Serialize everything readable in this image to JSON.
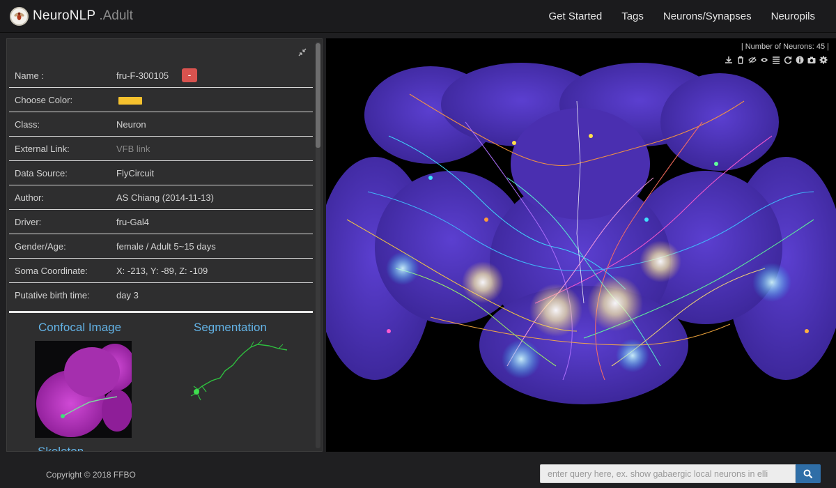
{
  "brand": {
    "name": "NeuroNLP",
    "subtitle": ".Adult",
    "logo_icon": "fruit-fly-logo-icon"
  },
  "nav": {
    "items": [
      "Get Started",
      "Tags",
      "Neurons/Synapses",
      "Neuropils"
    ]
  },
  "info_panel": {
    "rows": [
      {
        "label": "Name :",
        "value": "fru-F-300105",
        "remove_label": "-"
      },
      {
        "label": "Choose Color:",
        "swatch_color": "#f5c12e"
      },
      {
        "label": "Class:",
        "value": "Neuron"
      },
      {
        "label": "External Link:",
        "value": "VFB link"
      },
      {
        "label": "Data Source:",
        "value": "FlyCircuit"
      },
      {
        "label": "Author:",
        "value": "AS Chiang (2014-11-13)"
      },
      {
        "label": "Driver:",
        "value": "fru-Gal4"
      },
      {
        "label": "Gender/Age:",
        "value": "female / Adult 5~15 days"
      },
      {
        "label": "Soma Coordinate:",
        "value": "X: -213, Y: -89, Z: -109"
      },
      {
        "label": "Putative birth time:",
        "value": "day 3"
      }
    ],
    "media": {
      "confocal_title": "Confocal Image",
      "segmentation_title": "Segmentation",
      "skeleton_title": "Skeleton"
    }
  },
  "viewer": {
    "neuron_count": "| Number of Neurons: 45 |",
    "toolbar_icons": [
      "download-icon",
      "trash-icon",
      "eye-slash-icon",
      "eye-icon",
      "list-icon",
      "refresh-icon",
      "info-icon",
      "camera-icon",
      "gear-icon"
    ]
  },
  "footer": {
    "copyright": "Copyright © 2018 FFBO",
    "search_placeholder": "enter query here, ex. show gabaergic local neurons in elli"
  },
  "colors": {
    "accent_blue": "#63b3e6",
    "remove_red": "#d9534f",
    "search_button": "#2f6ea7",
    "brain_purple": "#4a2fb0"
  }
}
